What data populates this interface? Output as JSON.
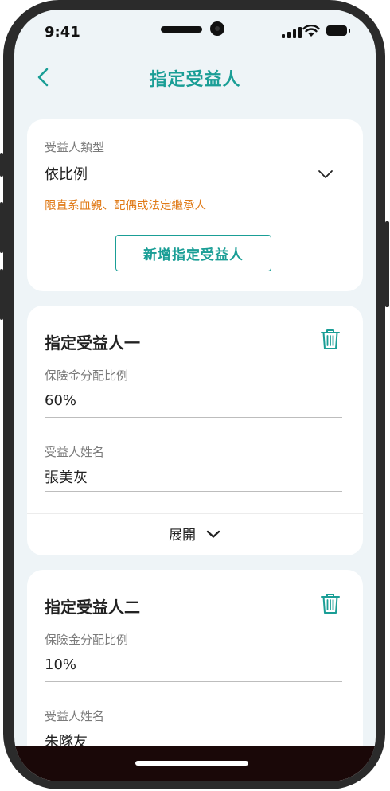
{
  "status_bar": {
    "time": "9:41"
  },
  "nav": {
    "title": "指定受益人",
    "back_icon": "chevron-left-icon"
  },
  "type_card": {
    "label": "受益人類型",
    "value": "依比例",
    "note": "限直系血親、配偶或法定繼承人",
    "add_button": "新增指定受益人"
  },
  "beneficiaries": [
    {
      "title": "指定受益人一",
      "ratio_label": "保險金分配比例",
      "ratio_value": "60%",
      "name_label": "受益人姓名",
      "name_value": "張美灰",
      "expand_label": "展開"
    },
    {
      "title": "指定受益人二",
      "ratio_label": "保險金分配比例",
      "ratio_value": "10%",
      "name_label": "受益人姓名",
      "name_value": "朱隊友"
    }
  ],
  "colors": {
    "accent": "#1a9e96",
    "warning": "#e07a17",
    "background": "#eef4f7"
  }
}
